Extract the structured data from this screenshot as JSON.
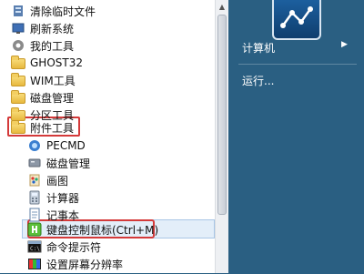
{
  "start_menu": {
    "items": [
      {
        "label": "清除临时文件",
        "icon": "broom-icon"
      },
      {
        "label": "刷新系统",
        "icon": "refresh-icon"
      },
      {
        "label": "我的工具",
        "icon": "tools-icon"
      },
      {
        "label": "GHOST32",
        "icon": "folder-icon"
      },
      {
        "label": "WIM工具",
        "icon": "folder-icon"
      },
      {
        "label": "磁盘管理",
        "icon": "folder-icon"
      },
      {
        "label": "分区工具",
        "icon": "folder-icon"
      },
      {
        "label": "附件工具",
        "icon": "folder-icon"
      },
      {
        "label": "PECMD",
        "icon": "gear-icon"
      },
      {
        "label": "磁盘管理",
        "icon": "disk-icon"
      },
      {
        "label": "画图",
        "icon": "paint-icon"
      },
      {
        "label": "计算器",
        "icon": "calculator-icon"
      },
      {
        "label": "记事本",
        "icon": "notepad-icon"
      },
      {
        "label": "键盘控制鼠标(Ctrl+M)",
        "icon": "keyboard-mouse-icon"
      },
      {
        "label": "命令提示符",
        "icon": "cmd-icon"
      },
      {
        "label": "设置屏幕分辨率",
        "icon": "display-icon"
      }
    ]
  },
  "right_panel": {
    "computer": "计算机",
    "run": "运行..."
  },
  "colors": {
    "highlight_border": "#d43a3a",
    "hover_bg": "#e3eef9",
    "right_bg": "#2a5f82"
  }
}
